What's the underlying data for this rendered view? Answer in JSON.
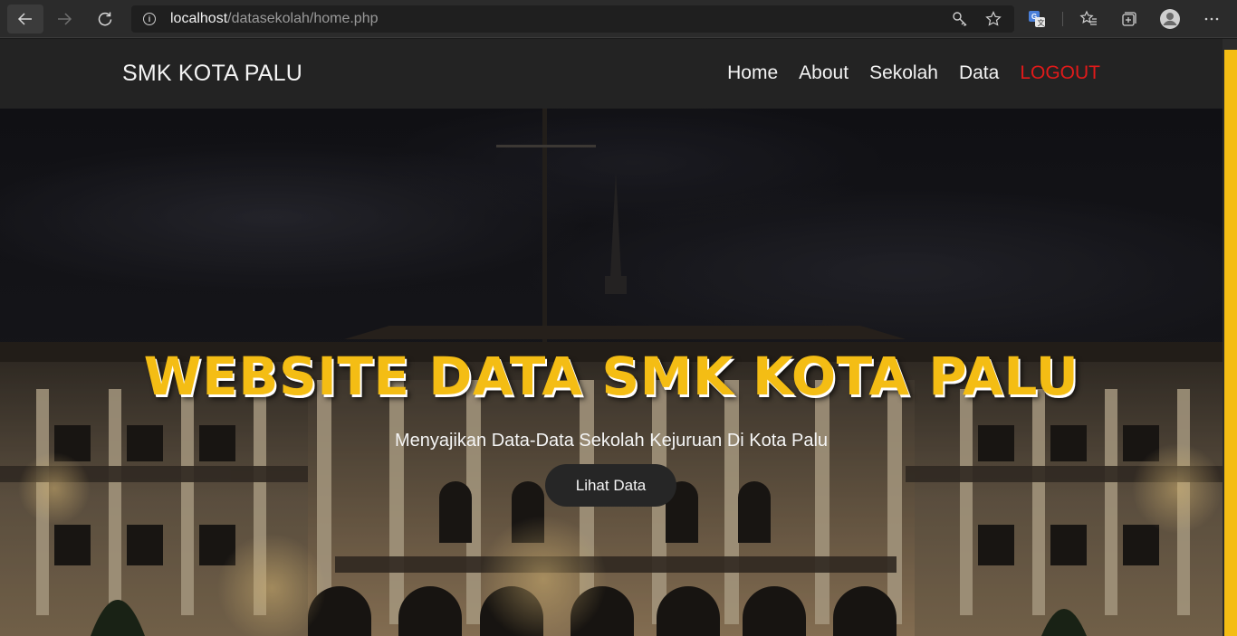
{
  "browser": {
    "url_host": "localhost",
    "url_path": "/datasekolah/home.php",
    "icons": [
      "back-icon",
      "forward-icon",
      "reload-icon",
      "info-icon",
      "key-icon",
      "star-icon",
      "translate-icon",
      "favorites-icon",
      "collections-icon",
      "profile-icon",
      "more-icon"
    ]
  },
  "navbar": {
    "brand": "SMK KOTA PALU",
    "links": [
      {
        "label": "Home"
      },
      {
        "label": "About"
      },
      {
        "label": "Sekolah"
      },
      {
        "label": "Data"
      },
      {
        "label": "LOGOUT"
      }
    ]
  },
  "hero": {
    "title": "WEBSITE DATA SMK KOTA PALU",
    "subtitle": "Menyajikan Data-Data Sekolah Kejuruan Di Kota Palu",
    "button_label": "Lihat Data"
  },
  "colors": {
    "accent": "#f4bd14",
    "logout": "#e01a1a",
    "navbar_bg": "#232323",
    "button_bg": "#262626"
  }
}
